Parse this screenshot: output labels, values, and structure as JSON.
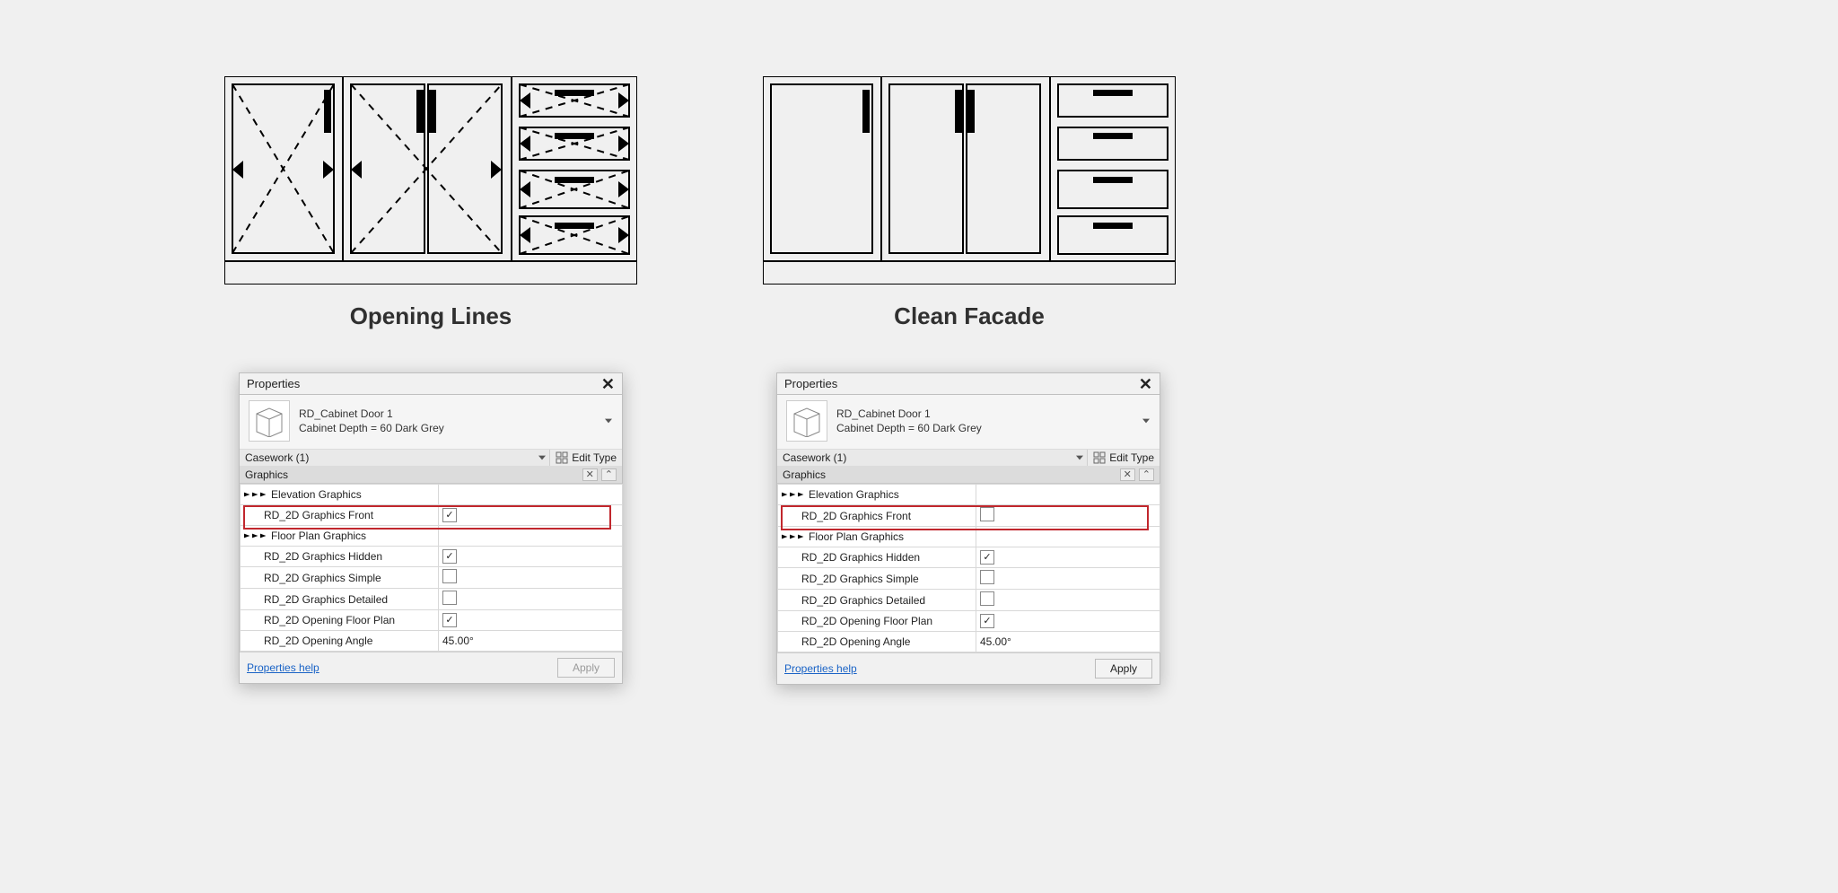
{
  "captions": {
    "left": "Opening Lines",
    "right": "Clean Facade"
  },
  "panel": {
    "title": "Properties",
    "family_name": "RD_Cabinet Door 1",
    "family_type": "Cabinet Depth = 60 Dark Grey",
    "category_label": "Casework (1)",
    "edit_type_label": "Edit Type",
    "section_header": "Graphics",
    "help_label": "Properties help",
    "apply_label": "Apply"
  },
  "rows": [
    {
      "label": "Elevation Graphics",
      "arrows": true,
      "value_type": "none"
    },
    {
      "label": "RD_2D Graphics Front",
      "value_type": "checkbox",
      "highlight": true
    },
    {
      "label": "Floor Plan Graphics",
      "arrows": true,
      "value_type": "none"
    },
    {
      "label": "RD_2D Graphics Hidden",
      "value_type": "checkbox"
    },
    {
      "label": "RD_2D Graphics Simple",
      "value_type": "checkbox"
    },
    {
      "label": "RD_2D Graphics Detailed",
      "value_type": "checkbox"
    },
    {
      "label": "RD_2D Opening Floor Plan",
      "value_type": "checkbox"
    },
    {
      "label": "RD_2D Opening Angle",
      "value_type": "text",
      "value": "45.00°"
    }
  ],
  "left_values": {
    "RD_2D Graphics Front": true,
    "RD_2D Graphics Hidden": true,
    "RD_2D Graphics Simple": false,
    "RD_2D Graphics Detailed": false,
    "RD_2D Opening Floor Plan": true
  },
  "right_values": {
    "RD_2D Graphics Front": false,
    "RD_2D Graphics Hidden": true,
    "RD_2D Graphics Simple": false,
    "RD_2D Graphics Detailed": false,
    "RD_2D Opening Floor Plan": true
  }
}
